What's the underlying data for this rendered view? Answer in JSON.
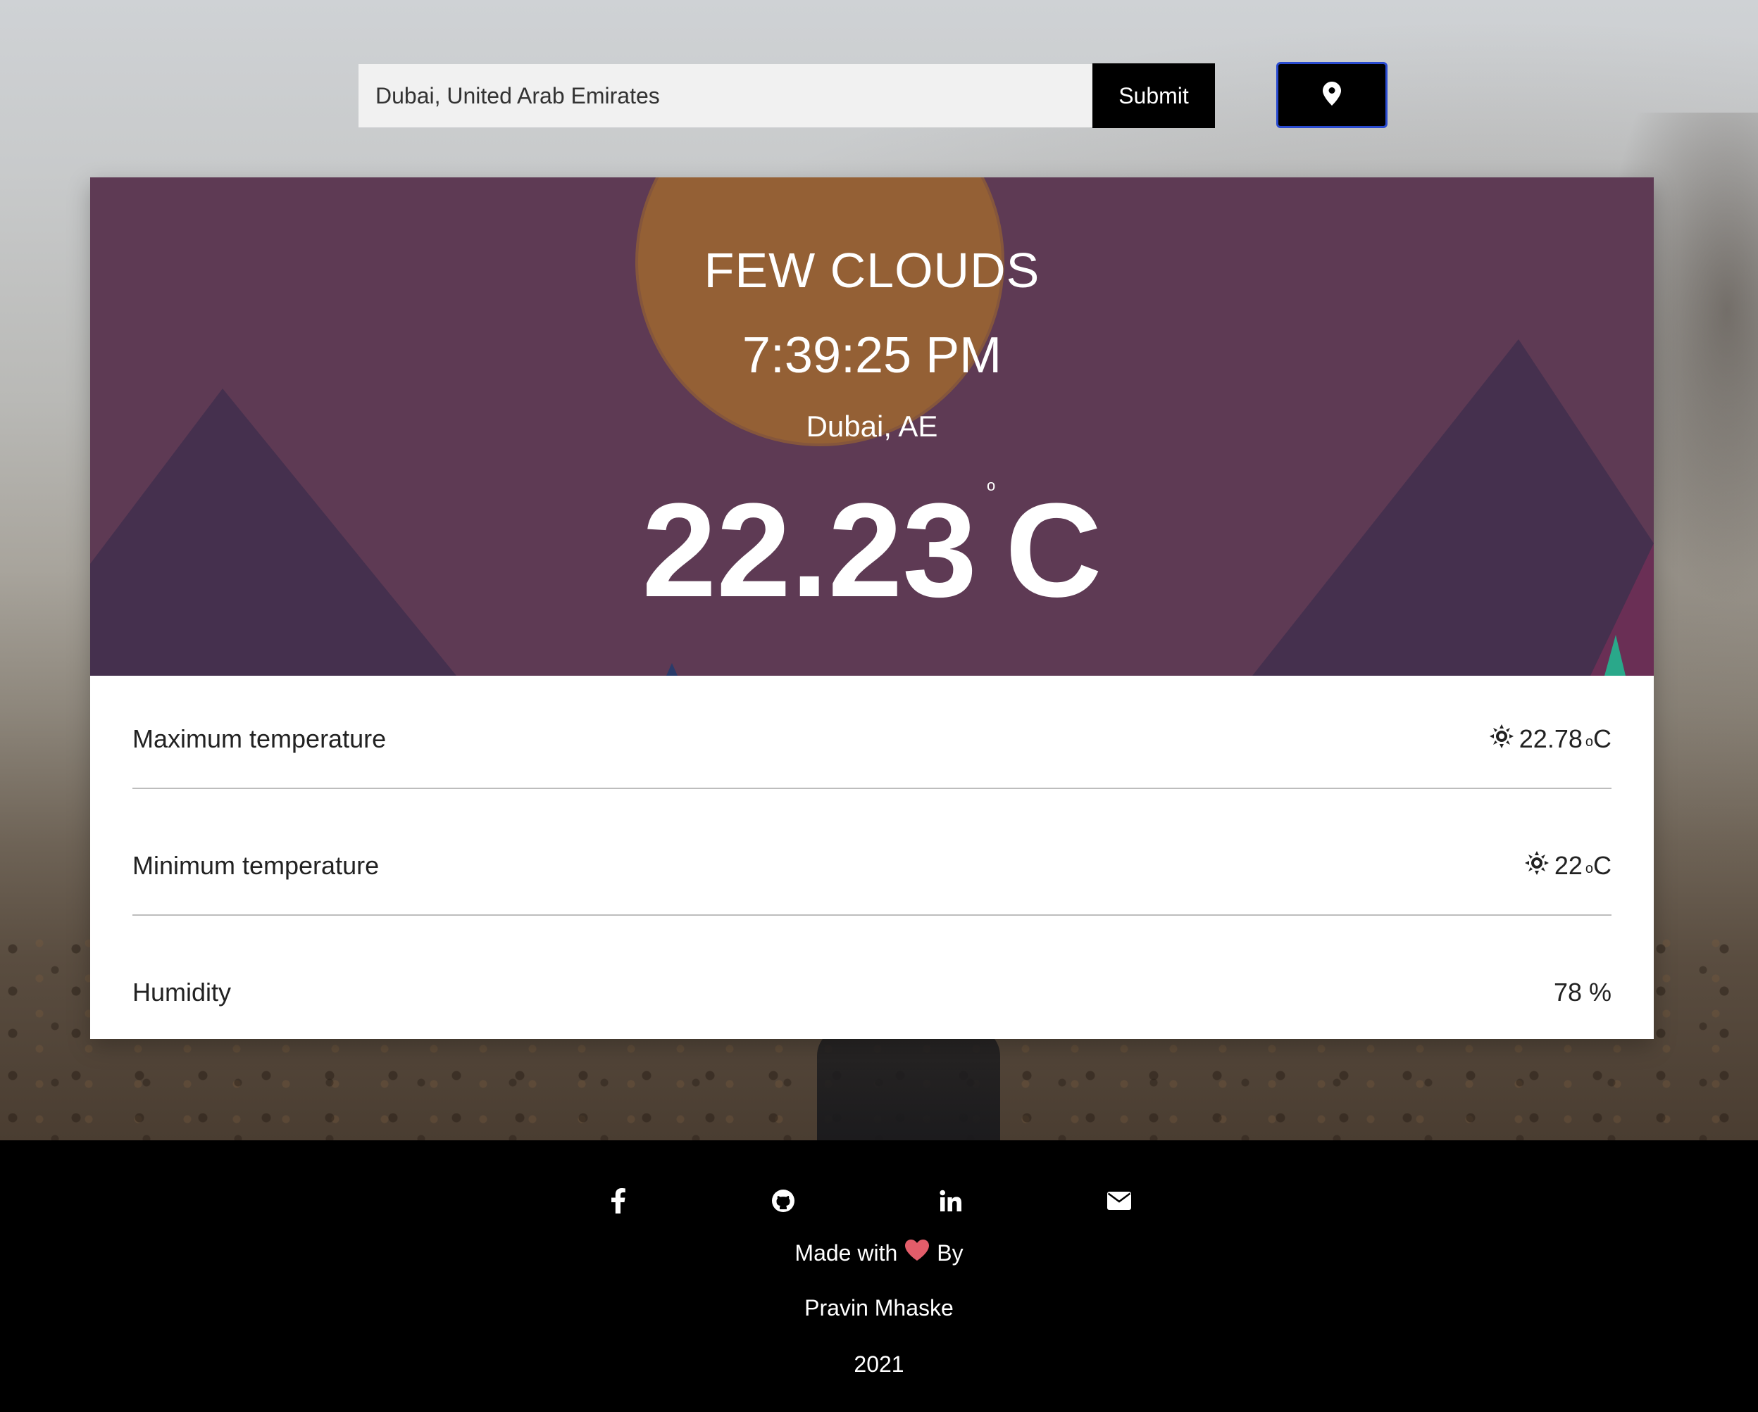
{
  "search": {
    "value": "Dubai, United Arab Emirates",
    "submit_label": "Submit"
  },
  "weather": {
    "condition": "FEW CLOUDS",
    "time": "7:39:25 PM",
    "location": "Dubai, AE",
    "temperature": "22.23",
    "degree_symbol": "o",
    "unit": "C"
  },
  "details": [
    {
      "label": "Maximum temperature",
      "value": "22.78",
      "unit_sup": "o",
      "unit": "C",
      "icon": "sun-icon"
    },
    {
      "label": "Minimum temperature",
      "value": "22",
      "unit_sup": "o",
      "unit": "C",
      "icon": "sun-icon"
    },
    {
      "label": "Humidity",
      "value": "78 %"
    }
  ],
  "footer": {
    "social": [
      "facebook-icon",
      "github-icon",
      "linkedin-icon",
      "envelope-icon"
    ],
    "made_with_prefix": "Made with",
    "made_with_suffix": "By",
    "author": "Pravin Mhaske",
    "year": "2021"
  },
  "colors": {
    "hero_bg": "#5e3a54",
    "sun": "#b07a2a",
    "locate_border": "#2a4bd0",
    "heart": "#e35d6a"
  }
}
